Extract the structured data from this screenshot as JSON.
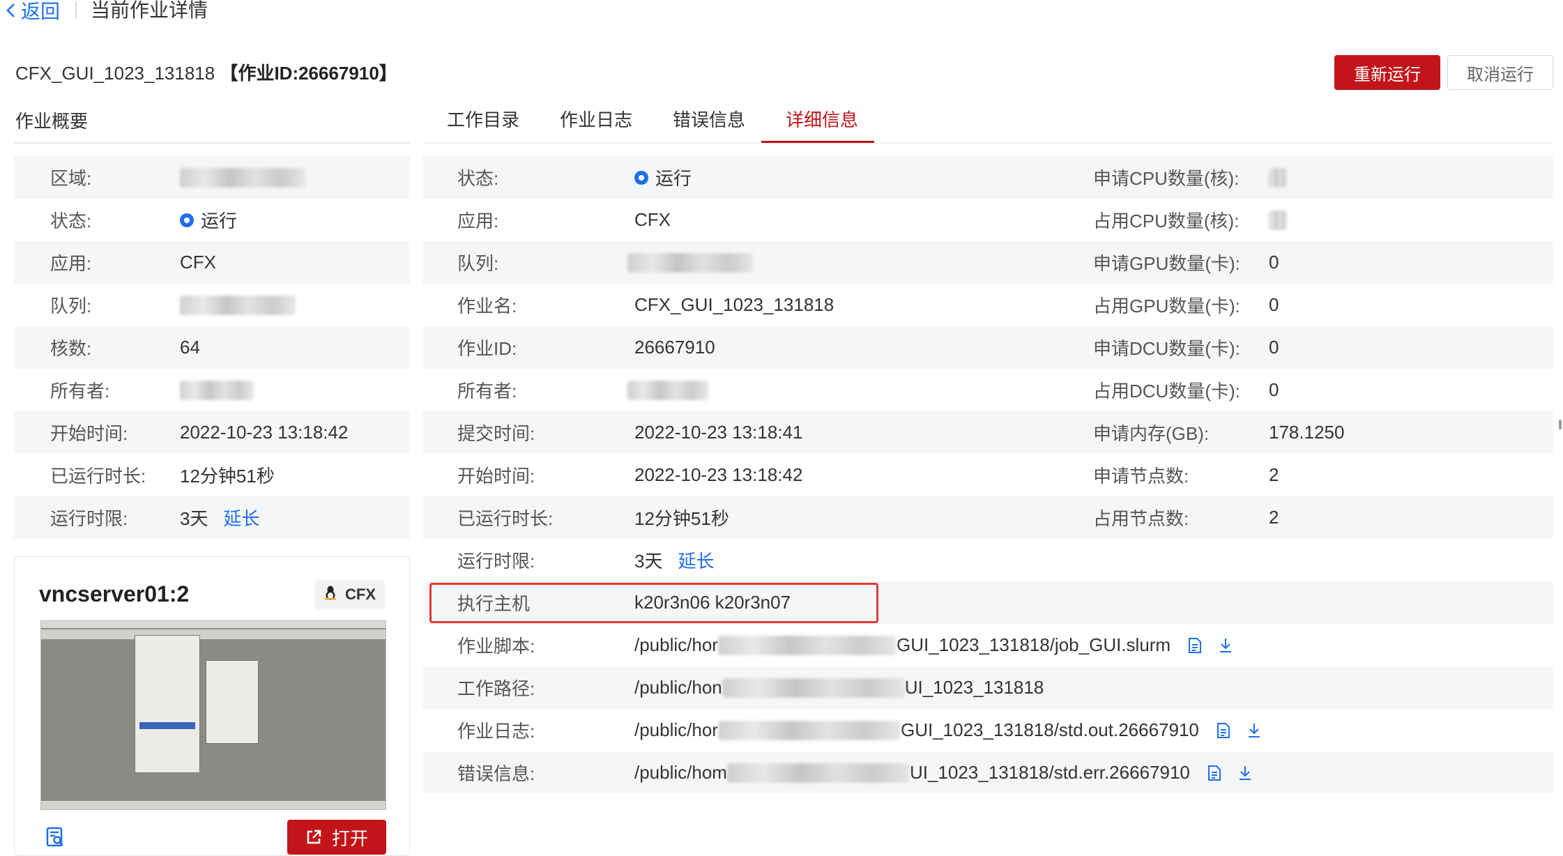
{
  "topbar": {
    "back_label": "返回",
    "breadcrumb": "当前作业详情"
  },
  "job": {
    "name": "CFX_GUI_1023_131818",
    "id_label": "【作业ID:26667910】"
  },
  "actions": {
    "rerun": "重新运行",
    "cancel": "取消运行"
  },
  "summary": {
    "title": "作业概要",
    "rows": [
      {
        "label": "区域:",
        "value": ""
      },
      {
        "label": "状态:",
        "value": "运行"
      },
      {
        "label": "应用:",
        "value": "CFX"
      },
      {
        "label": "队列:",
        "value": ""
      },
      {
        "label": "核数:",
        "value": "64"
      },
      {
        "label": "所有者:",
        "value": ""
      },
      {
        "label": "开始时间:",
        "value": "2022-10-23 13:18:42"
      },
      {
        "label": "已运行时长:",
        "value": "12分钟51秒"
      },
      {
        "label": "运行时限:",
        "value": "3天",
        "link": "延长"
      }
    ]
  },
  "vnc": {
    "title": "vncserver01:2",
    "os_label": "CFX",
    "open_label": "打开",
    "icon": "linux-icon"
  },
  "tabs": [
    {
      "label": "工作目录",
      "active": false
    },
    {
      "label": "作业日志",
      "active": false
    },
    {
      "label": "错误信息",
      "active": false
    },
    {
      "label": "详细信息",
      "active": true
    }
  ],
  "detail": {
    "rows": [
      {
        "label": "状态:",
        "value": "运行",
        "label2": "申请CPU数量(核):",
        "value2": ""
      },
      {
        "label": "应用:",
        "value": "CFX",
        "label2": "占用CPU数量(核):",
        "value2": ""
      },
      {
        "label": "队列:",
        "value": "",
        "label2": "申请GPU数量(卡):",
        "value2": "0"
      },
      {
        "label": "作业名:",
        "value": "CFX_GUI_1023_131818",
        "label2": "占用GPU数量(卡):",
        "value2": "0"
      },
      {
        "label": "作业ID:",
        "value": "26667910",
        "label2": "申请DCU数量(卡):",
        "value2": "0"
      },
      {
        "label": "所有者:",
        "value": "",
        "label2": "占用DCU数量(卡):",
        "value2": "0"
      },
      {
        "label": "提交时间:",
        "value": "2022-10-23 13:18:41",
        "label2": "申请内存(GB):",
        "value2": "178.1250"
      },
      {
        "label": "开始时间:",
        "value": "2022-10-23 13:18:42",
        "label2": "申请节点数:",
        "value2": "2"
      },
      {
        "label": "已运行时长:",
        "value": "12分钟51秒",
        "label2": "占用节点数:",
        "value2": "2"
      },
      {
        "label": "运行时限:",
        "value": "3天",
        "link": "延长"
      },
      {
        "label": "执行主机",
        "value": "k20r3n06 k20r3n07"
      },
      {
        "label": "作业脚本:",
        "value_pre": "/public/hor",
        "value_post": "GUI_1023_131818/job_GUI.slurm"
      },
      {
        "label": "工作路径:",
        "value_pre": "/public/hon",
        "value_post": "UI_1023_131818"
      },
      {
        "label": "作业日志:",
        "value_pre": "/public/hor",
        "value_post": "GUI_1023_131818/std.out.26667910"
      },
      {
        "label": "错误信息:",
        "value_pre": "/public/hom",
        "value_post": "UI_1023_131818/std.err.26667910"
      }
    ]
  },
  "colors": {
    "brand": "#c3141a",
    "link": "#1f6feb",
    "highlight_box": "#e53935"
  }
}
